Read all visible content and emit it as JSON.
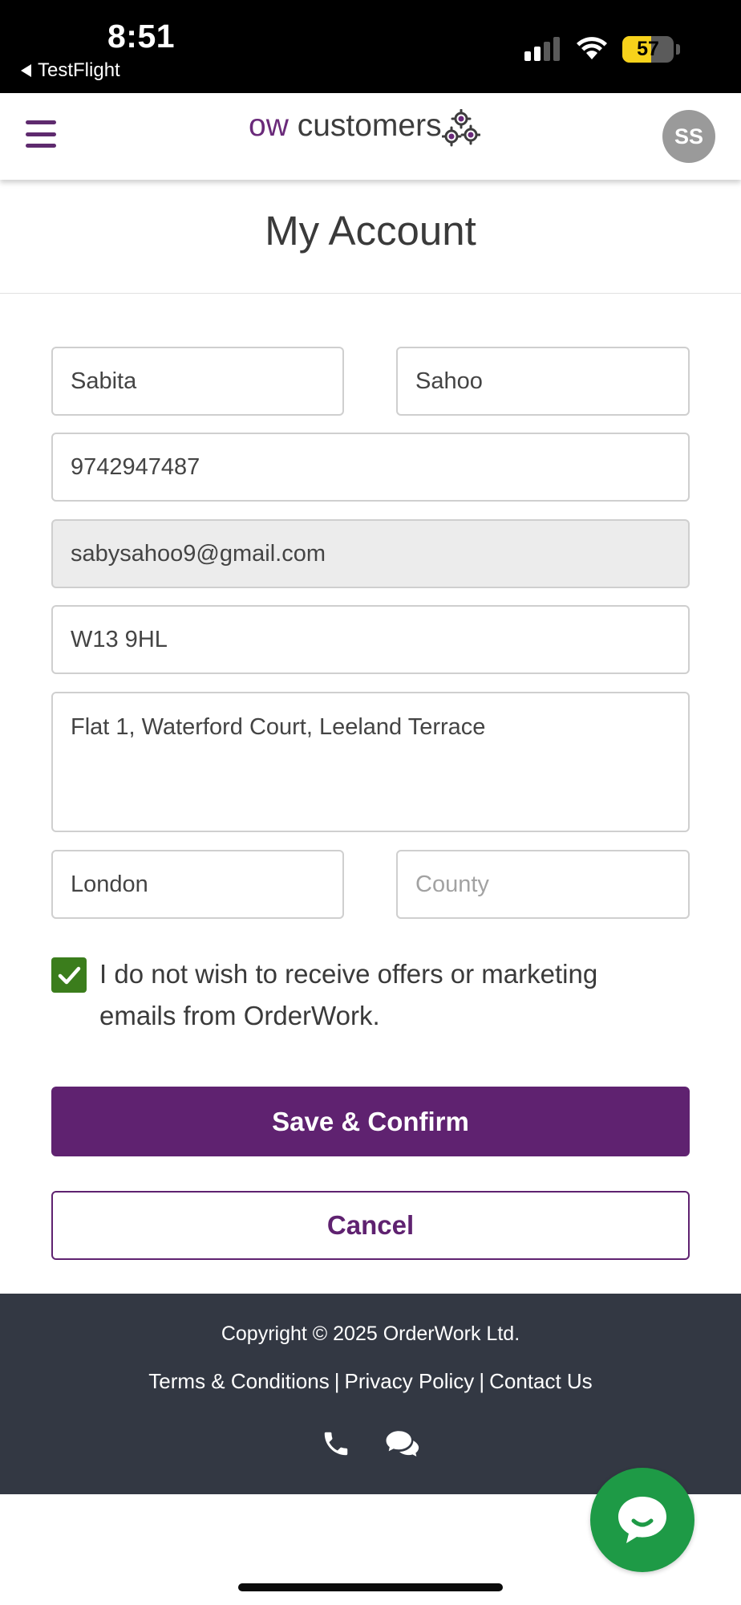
{
  "status_bar": {
    "time": "8:51",
    "back_app": "TestFlight",
    "battery": "57",
    "battery_level": 0.57
  },
  "header": {
    "brand_prefix": "ow",
    "brand_suffix": " customers",
    "avatar_initials": "SS",
    "menu_icon": "hamburger-icon",
    "logo_icon": "gears-icon"
  },
  "page": {
    "title": "My Account"
  },
  "form": {
    "first_name": {
      "value": "Sabita"
    },
    "last_name": {
      "value": "Sahoo"
    },
    "phone": {
      "value": "9742947487"
    },
    "email": {
      "value": "sabysahoo9@gmail.com",
      "readonly": true
    },
    "postcode": {
      "value": "W13 9HL"
    },
    "address": {
      "value": "Flat 1, Waterford Court, Leeland Terrace"
    },
    "city": {
      "value": "London"
    },
    "county": {
      "value": "",
      "placeholder": "County"
    },
    "marketing_opt_out": {
      "checked": true,
      "label": "I do not wish to receive offers or marketing emails from OrderWork."
    },
    "save_label": "Save & Confirm",
    "cancel_label": "Cancel"
  },
  "footer": {
    "copyright": "Copyright © 2025 OrderWork Ltd.",
    "links": [
      "Terms & Conditions",
      "Privacy Policy",
      "Contact Us"
    ],
    "separator": "|",
    "icons": [
      "phone-icon",
      "chat-bubbles-icon"
    ]
  },
  "chat_button": {
    "icon": "chat-icon"
  },
  "colors": {
    "brand_purple": "#5f2270",
    "checkbox_green": "#3b7d1c",
    "chat_green": "#1e9a46",
    "footer_bg": "#333843",
    "battery_yellow": "#f7d21b"
  }
}
